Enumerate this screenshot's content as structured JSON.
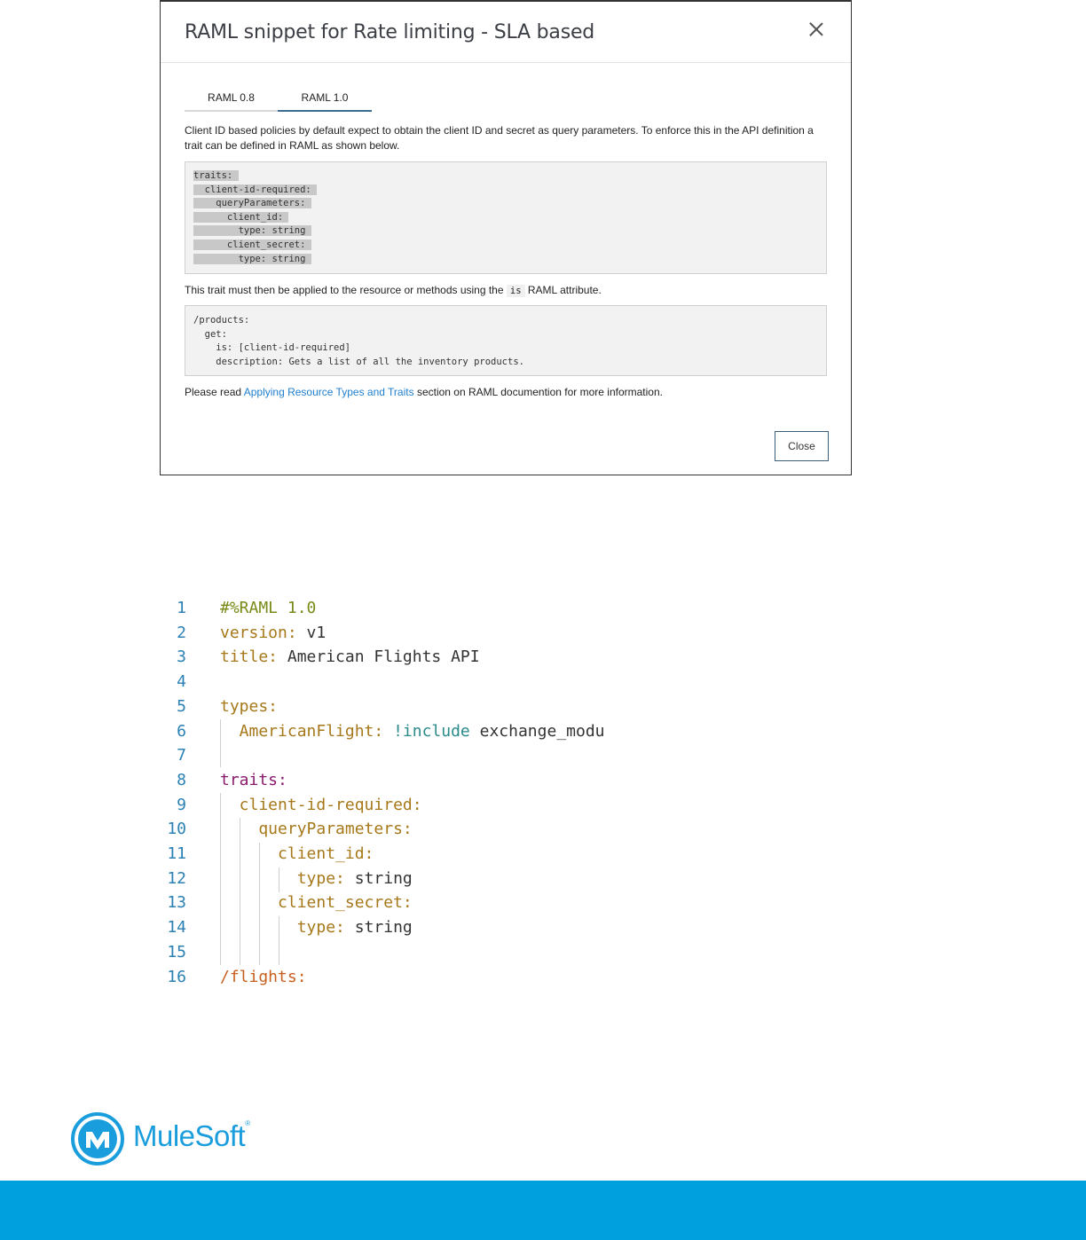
{
  "modal": {
    "title": "RAML snippet for Rate limiting - SLA based",
    "tabs": [
      {
        "label": "RAML 0.8",
        "active": false
      },
      {
        "label": "RAML 1.0",
        "active": true
      }
    ],
    "intro": "Client ID based policies by default expect to obtain the client ID and secret as query parameters. To enforce this in the API definition a trait can be defined in RAML as shown below.",
    "code1": [
      "traits:",
      "  client-id-required:",
      "    queryParameters:",
      "      client_id:",
      "        type: string",
      "      client_secret:",
      "        type: string"
    ],
    "apply_text_before": "This trait must then be applied to the resource or methods using the",
    "apply_code": "is",
    "apply_text_after": "RAML attribute.",
    "code2": [
      "/products:",
      "  get:",
      "    is: [client-id-required]",
      "    description: Gets a list of all the inventory products."
    ],
    "read_before": "Please read",
    "read_link": "Applying Resource Types and Traits",
    "read_after": "section on RAML documention for more information.",
    "close_button": "Close"
  },
  "editor": {
    "lines": [
      {
        "n": "1",
        "parts": [
          [
            "#%RAML 1.0",
            "comment"
          ]
        ]
      },
      {
        "n": "2",
        "parts": [
          [
            "version:",
            "key"
          ],
          [
            " v1",
            "val"
          ]
        ]
      },
      {
        "n": "3",
        "parts": [
          [
            "title:",
            "key"
          ],
          [
            " American Flights API",
            "val"
          ]
        ]
      },
      {
        "n": "4",
        "parts": []
      },
      {
        "n": "5",
        "parts": [
          [
            "types:",
            "key"
          ]
        ]
      },
      {
        "n": "6",
        "parts": [
          [
            "  AmericanFlight:",
            "key"
          ],
          [
            " !include",
            "tag"
          ],
          [
            " exchange_modu",
            "val"
          ]
        ]
      },
      {
        "n": "7",
        "parts": []
      },
      {
        "n": "8",
        "parts": [
          [
            "traits:",
            "root"
          ]
        ]
      },
      {
        "n": "9",
        "parts": [
          [
            "  client-id-required:",
            "key"
          ]
        ]
      },
      {
        "n": "10",
        "parts": [
          [
            "    queryParameters:",
            "key"
          ]
        ]
      },
      {
        "n": "11",
        "parts": [
          [
            "      client_id:",
            "key"
          ]
        ]
      },
      {
        "n": "12",
        "parts": [
          [
            "        type:",
            "key"
          ],
          [
            " string",
            "val"
          ]
        ]
      },
      {
        "n": "13",
        "parts": [
          [
            "      client_secret:",
            "key"
          ]
        ]
      },
      {
        "n": "14",
        "parts": [
          [
            "        type:",
            "key"
          ],
          [
            " string",
            "val"
          ]
        ]
      },
      {
        "n": "15",
        "parts": []
      },
      {
        "n": "16",
        "parts": [
          [
            "/flights:",
            "path"
          ]
        ]
      }
    ]
  },
  "footer": {
    "logo_text": "MuleSoft",
    "logo_mark": "®",
    "brand_color": "#00a0df"
  }
}
